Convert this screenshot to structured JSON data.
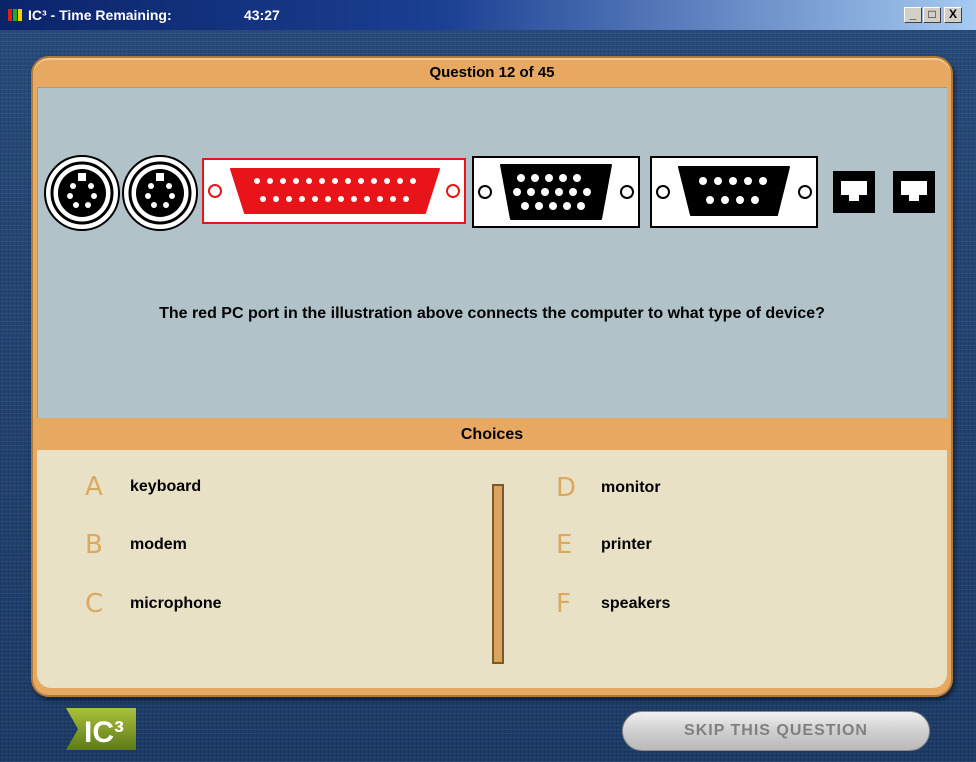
{
  "window": {
    "title": "IC³ - Time Remaining:",
    "time_remaining": "43:27",
    "minimize_label": "_",
    "maximize_label": "□",
    "close_label": "X"
  },
  "question": {
    "header": "Question 12 of 45",
    "text": "The red PC port in the illustration above connects the computer to what type of device?",
    "ports": [
      "ps2-keyboard-port-icon",
      "ps2-mouse-port-icon",
      "parallel-port-icon",
      "vga-port-icon",
      "serial-port-icon",
      "network-port-icon",
      "network-port-icon"
    ]
  },
  "choices": {
    "header": "Choices",
    "items": [
      {
        "letter": "A",
        "label": "keyboard"
      },
      {
        "letter": "B",
        "label": "modem"
      },
      {
        "letter": "C",
        "label": "microphone"
      },
      {
        "letter": "D",
        "label": "monitor"
      },
      {
        "letter": "E",
        "label": "printer"
      },
      {
        "letter": "F",
        "label": "speakers"
      }
    ]
  },
  "footer": {
    "logo_text": "IC³",
    "skip_label": "SKIP THIS QUESTION"
  },
  "colors": {
    "panel": "#e7a861",
    "question_bg": "#b1c3c9",
    "choices_bg": "#e8e1c6",
    "highlight_port": "#e8141a"
  }
}
